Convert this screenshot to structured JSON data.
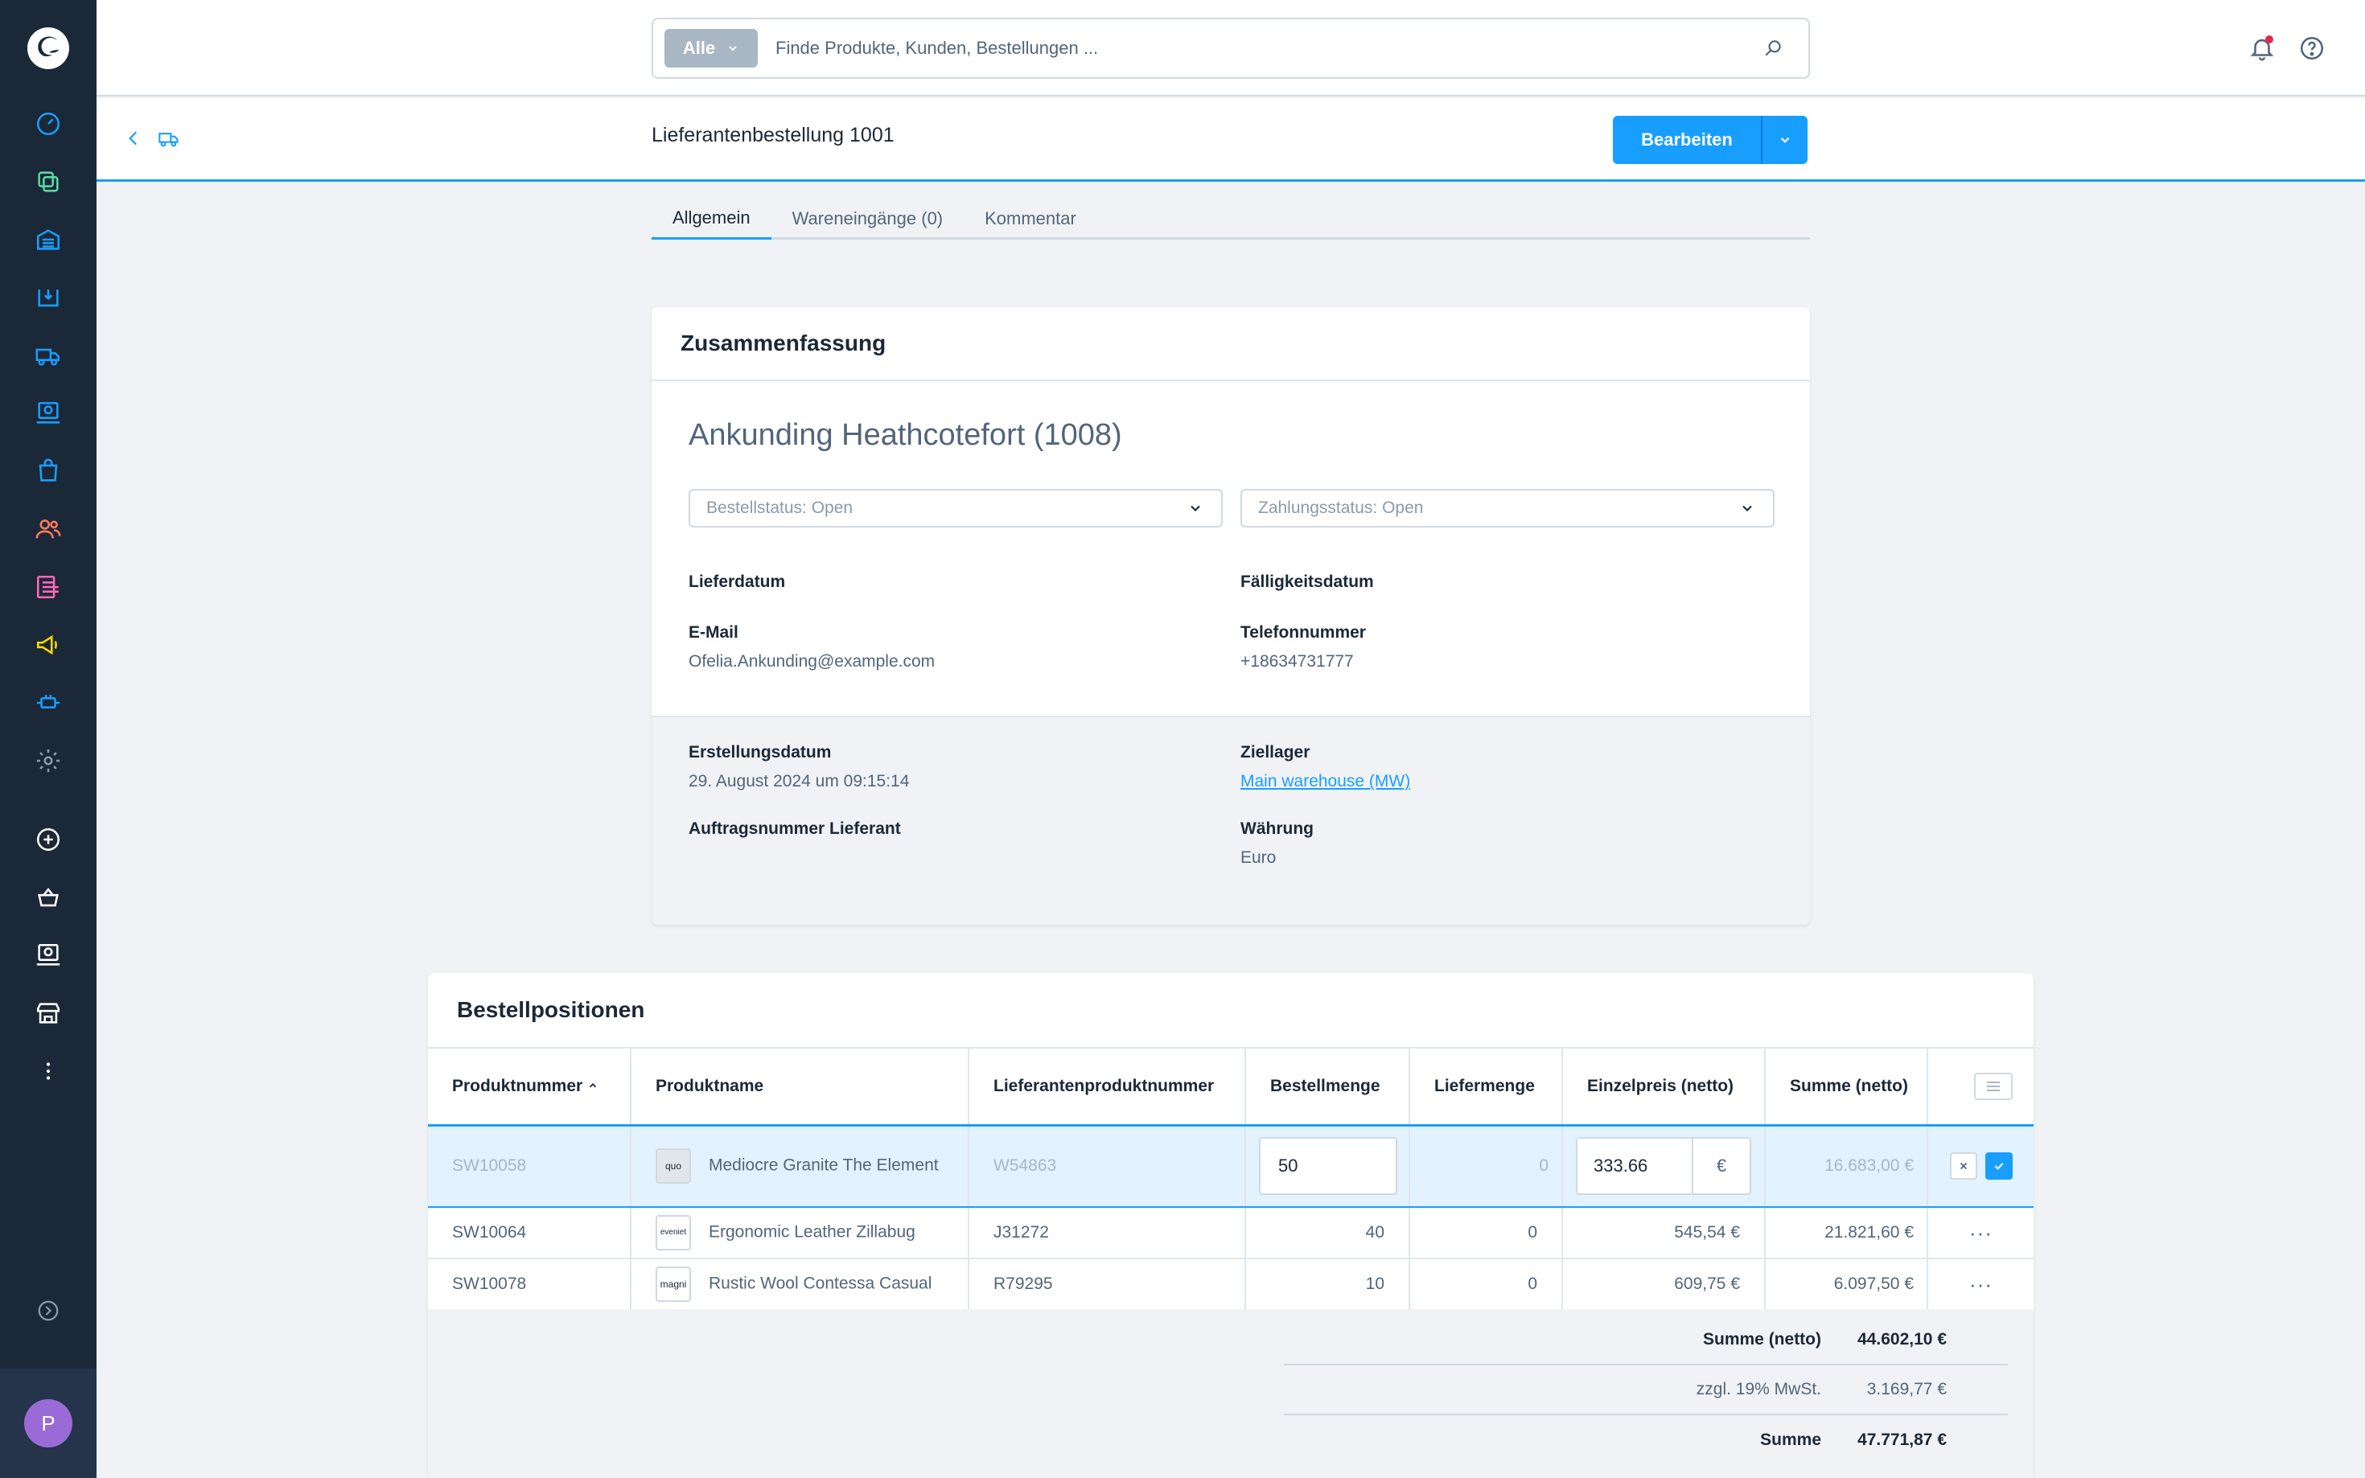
{
  "search": {
    "type_label": "Alle",
    "placeholder": "Finde Produkte, Kunden, Bestellungen ..."
  },
  "user": {
    "initial": "P"
  },
  "page": {
    "title": "Lieferantenbestellung 1001",
    "edit_label": "Bearbeiten"
  },
  "tabs": [
    {
      "label": "Allgemein",
      "active": true
    },
    {
      "label": "Wareneingänge (0)",
      "active": false
    },
    {
      "label": "Kommentar",
      "active": false
    }
  ],
  "summary": {
    "title": "Zusammenfassung",
    "supplier_name": "Ankunding Heathcotefort (1008)",
    "order_status": "Bestellstatus: Open",
    "payment_status": "Zahlungsstatus: Open",
    "delivery_date_label": "Lieferdatum",
    "due_date_label": "Fälligkeitsdatum",
    "email_label": "E-Mail",
    "email_value": "Ofelia.Ankunding@example.com",
    "phone_label": "Telefonnummer",
    "phone_value": "+18634731777",
    "created_label": "Erstellungsdatum",
    "created_value": "29. August 2024 um 09:15:14",
    "target_warehouse_label": "Ziellager",
    "target_warehouse_value": "Main warehouse (MW)",
    "supplier_order_number_label": "Auftragsnummer Lieferant",
    "currency_label": "Währung",
    "currency_value": "Euro"
  },
  "positions": {
    "title": "Bestellpositionen",
    "columns": [
      "Produktnummer",
      "Produktname",
      "Lieferantenproduktnummer",
      "Bestellmenge",
      "Liefermenge",
      "Einzelpreis (netto)",
      "Summe (netto)"
    ],
    "edit_row": {
      "product_number": "SW10058",
      "thumb": "quo",
      "product_name": "Mediocre Granite The Element",
      "supplier_product_number": "W54863",
      "order_qty": "50",
      "delivered_qty": "0",
      "unit_price": "333.66",
      "currency": "€",
      "sum": "16.683,00 €"
    },
    "rows": [
      {
        "product_number": "SW10064",
        "thumb": "eveniet",
        "product_name": "Ergonomic Leather Zillabug",
        "supplier_product_number": "J31272",
        "order_qty": "40",
        "delivered_qty": "0",
        "unit_price": "545,54 €",
        "sum": "21.821,60 €"
      },
      {
        "product_number": "SW10078",
        "thumb": "magni",
        "product_name": "Rustic Wool Contessa Casual",
        "supplier_product_number": "R79295",
        "order_qty": "10",
        "delivered_qty": "0",
        "unit_price": "609,75 €",
        "sum": "6.097,50 €"
      }
    ],
    "totals": {
      "net_label": "Summe (netto)",
      "net_value": "44.602,10 €",
      "vat_label": "zzgl. 19% MwSt.",
      "vat_value": "3.169,77 €",
      "total_label": "Summe",
      "total_value": "47.771,87 €"
    }
  },
  "colors": {
    "accent": "#189eff",
    "sidebar": "#1b2838",
    "avatar": "#9a6bd6"
  }
}
